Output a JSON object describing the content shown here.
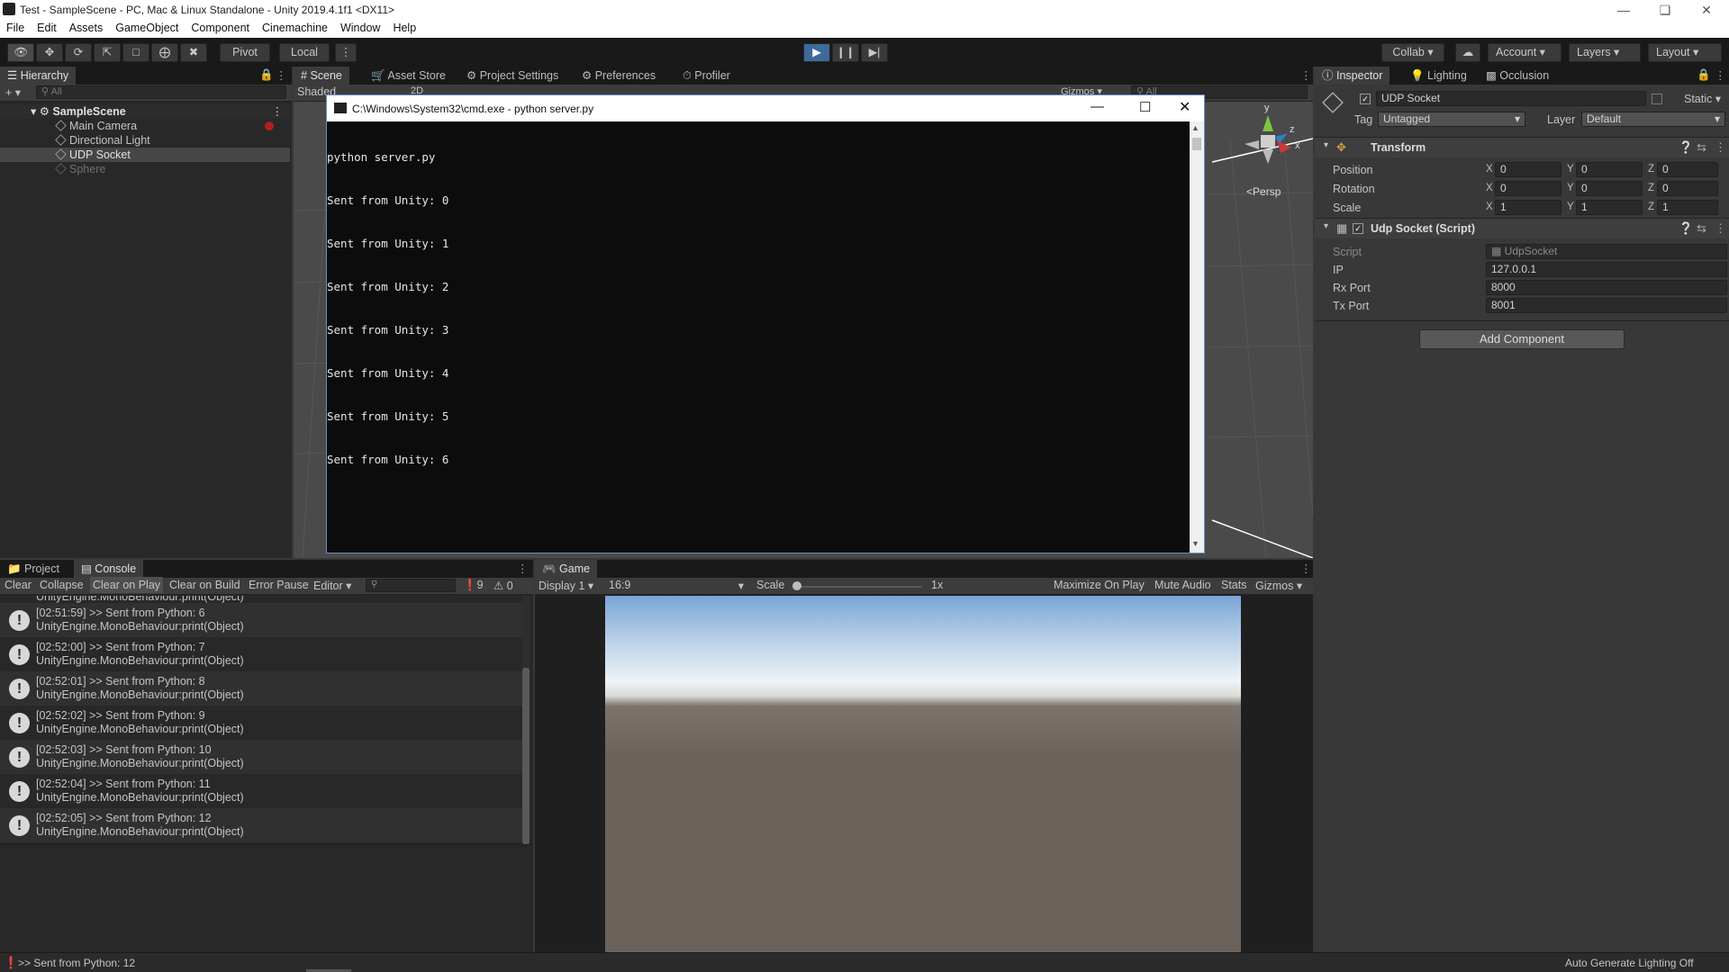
{
  "window": {
    "title": "Test - SampleScene - PC, Mac & Linux Standalone - Unity 2019.4.1f1 <DX11>"
  },
  "menu": [
    "File",
    "Edit",
    "Assets",
    "GameObject",
    "Component",
    "Cinemachine",
    "Window",
    "Help"
  ],
  "toolbar": {
    "pivot": "Pivot",
    "local": "Local",
    "collab": "Collab",
    "account": "Account",
    "layers": "Layers",
    "layout": "Layout"
  },
  "hierarchy": {
    "tab": "Hierarchy",
    "search_placeholder": "All",
    "scene": "SampleScene",
    "items": [
      "Main Camera",
      "Directional Light",
      "UDP Socket",
      "Sphere"
    ]
  },
  "scene_tabs": [
    "Scene",
    "Asset Store",
    "Project Settings",
    "Preferences",
    "Profiler"
  ],
  "scene_bar": {
    "shading": "Shaded",
    "mode": "2D",
    "gizmos": "Gizmos",
    "search_placeholder": "All"
  },
  "gizmo": {
    "y": "y",
    "z": "z",
    "x": "x",
    "persp": "Persp"
  },
  "cmd": {
    "title": "C:\\Windows\\System32\\cmd.exe - python  server.py",
    "lines": [
      "python server.py",
      "Sent from Unity: 0",
      "Sent from Unity: 1",
      "Sent from Unity: 2",
      "Sent from Unity: 3",
      "Sent from Unity: 4",
      "Sent from Unity: 5",
      "Sent from Unity: 6"
    ]
  },
  "inspector": {
    "tabs": [
      "Inspector",
      "Lighting",
      "Occlusion"
    ],
    "object_name": "UDP Socket",
    "static_label": "Static",
    "tag_label": "Tag",
    "tag_value": "Untagged",
    "layer_label": "Layer",
    "layer_value": "Default",
    "transform": {
      "title": "Transform",
      "rows": [
        {
          "label": "Position",
          "x": "0",
          "y": "0",
          "z": "0"
        },
        {
          "label": "Rotation",
          "x": "0",
          "y": "0",
          "z": "0"
        },
        {
          "label": "Scale",
          "x": "1",
          "y": "1",
          "z": "1"
        }
      ]
    },
    "script": {
      "title": "Udp Socket (Script)",
      "script_label": "Script",
      "script_value": "UdpSocket",
      "ip_label": "IP",
      "ip": "127.0.0.1",
      "rx_label": "Rx Port",
      "rx": "8000",
      "tx_label": "Tx Port",
      "tx": "8001"
    },
    "add_component": "Add Component"
  },
  "console": {
    "tabs": [
      "Project",
      "Console"
    ],
    "buttons": [
      "Clear",
      "Collapse",
      "Clear on Play",
      "Clear on Build",
      "Error Pause",
      "Editor"
    ],
    "log_count": "9",
    "warn_count": "0",
    "partial_text": "UnityEngine.MonoBehaviour:print(Object)",
    "entries": [
      {
        "msg": "[02:51:59] >> Sent from Python: 6",
        "trace": "UnityEngine.MonoBehaviour:print(Object)"
      },
      {
        "msg": "[02:52:00] >> Sent from Python: 7",
        "trace": "UnityEngine.MonoBehaviour:print(Object)"
      },
      {
        "msg": "[02:52:01] >> Sent from Python: 8",
        "trace": "UnityEngine.MonoBehaviour:print(Object)"
      },
      {
        "msg": "[02:52:02] >> Sent from Python: 9",
        "trace": "UnityEngine.MonoBehaviour:print(Object)"
      },
      {
        "msg": "[02:52:03] >> Sent from Python: 10",
        "trace": "UnityEngine.MonoBehaviour:print(Object)"
      },
      {
        "msg": "[02:52:04] >> Sent from Python: 11",
        "trace": "UnityEngine.MonoBehaviour:print(Object)"
      },
      {
        "msg": "[02:52:05] >> Sent from Python: 12",
        "trace": "UnityEngine.MonoBehaviour:print(Object)"
      }
    ]
  },
  "game": {
    "tab": "Game",
    "display": "Display 1",
    "aspect": "16:9",
    "scale_label": "Scale",
    "scale_value": "1x",
    "buttons": [
      "Maximize On Play",
      "Mute Audio",
      "Stats",
      "Gizmos"
    ]
  },
  "status": {
    "message": ">> Sent from Python: 12",
    "right": "Auto Generate Lighting Off"
  },
  "colors": {
    "accent": "#3d6b9a",
    "background": "#282828",
    "sky_top": "#7aa4d6",
    "ground": "#6b625c"
  }
}
